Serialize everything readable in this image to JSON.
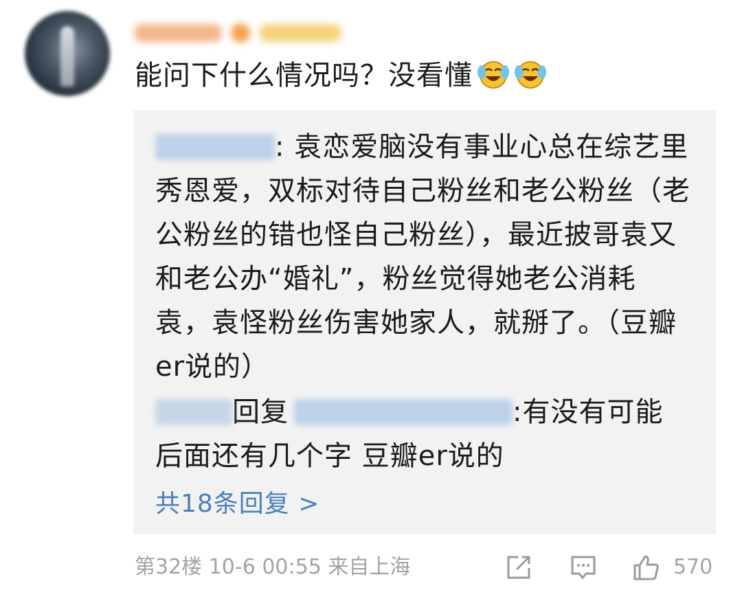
{
  "comment": {
    "text": "能问下什么情况吗？没看懂",
    "emojis": [
      "laughing-crying-emoji",
      "laughing-crying-emoji"
    ]
  },
  "reply_box": {
    "reply1": {
      "text": ": 袁恋爱脑没有事业心总在综艺里秀恩爱，双标对待自己粉丝和老公粉丝（老公粉丝的错也怪自己粉丝），最近披哥袁又和老公办“婚礼”，粉丝觉得她老公消耗袁，袁怪粉丝伤害她家人，就掰了。（豆瓣er说的）"
    },
    "reply2": {
      "reply_word": "回复",
      "text": ":有没有可能后面还有几个字 豆瓣er说的"
    },
    "more_replies": "共18条回复 >"
  },
  "footer": {
    "meta": "第32楼 10-6 00:55 来自上海",
    "like_count": "570"
  },
  "colors": {
    "link_blue": "#4a7fbf",
    "meta_gray": "#a3a3a3",
    "reply_bg": "#f2f2f2"
  }
}
